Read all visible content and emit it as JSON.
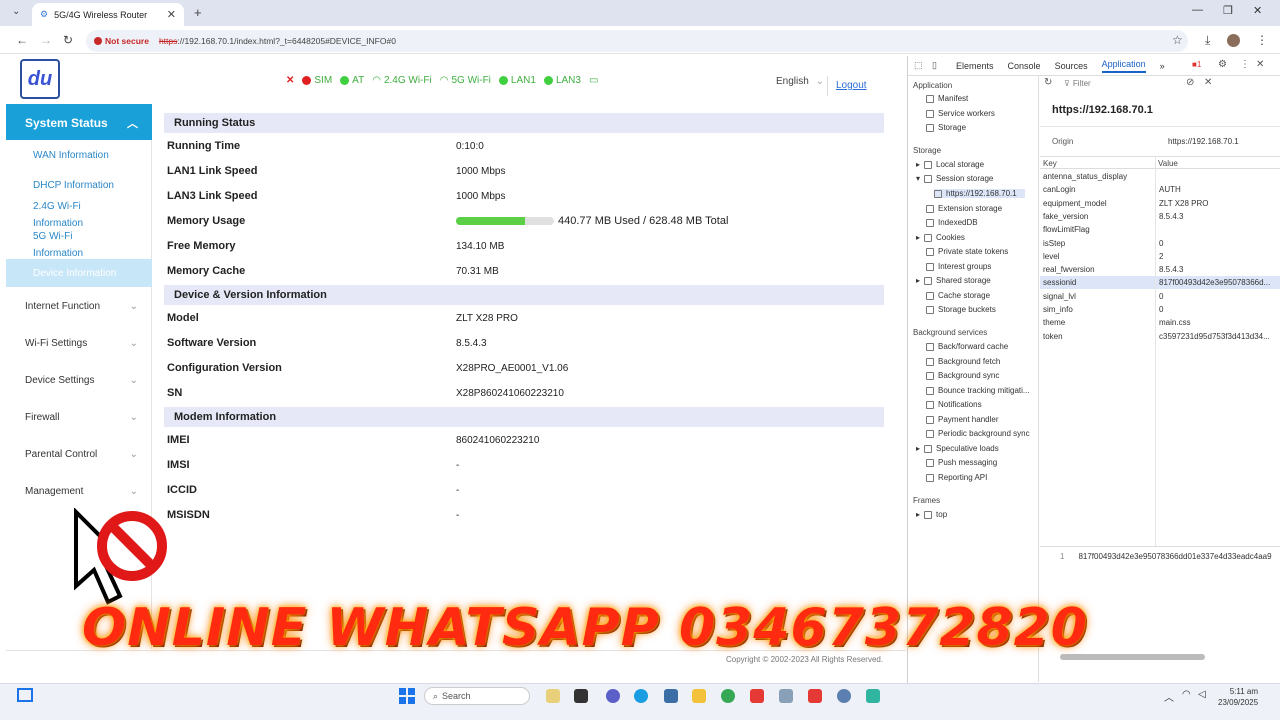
{
  "browser": {
    "tab_title": "5G/4G Wireless Router",
    "not_secure": "Not secure",
    "url_scheme": "https",
    "url_rest": "://192.168.70.1/index.html?_t=6448205#DEVICE_INFO#0"
  },
  "header": {
    "logo_text": "du",
    "status": [
      {
        "label": "SIM",
        "color": "#e02020"
      },
      {
        "label": "AT",
        "color": "#3fcf3f"
      },
      {
        "label": "2.4G Wi-Fi",
        "color": "#3fcf3f"
      },
      {
        "label": "5G Wi-Fi",
        "color": "#3fcf3f"
      },
      {
        "label": "LAN1",
        "color": "#3fcf3f"
      },
      {
        "label": "LAN3",
        "color": "#3fcf3f"
      }
    ],
    "language": "English",
    "logout": "Logout"
  },
  "sidebar": {
    "system_status": "System Status",
    "sub_items": [
      "WAN Information",
      "DHCP Information",
      "2.4G Wi-Fi",
      "Information",
      "5G Wi-Fi",
      "Information",
      "Device Information"
    ],
    "menus": [
      "Internet Function",
      "Wi-Fi Settings",
      "Device Settings",
      "Firewall",
      "Parental Control",
      "Management"
    ]
  },
  "running_status": {
    "title": "Running Status",
    "rows": [
      {
        "label": "Running Time",
        "value": "0:10:0"
      },
      {
        "label": "LAN1 Link Speed",
        "value": "1000 Mbps"
      },
      {
        "label": "LAN3 Link Speed",
        "value": "1000 Mbps"
      },
      {
        "label": "Memory Usage",
        "value": ""
      },
      {
        "label": "Free Memory",
        "value": "134.10 MB"
      },
      {
        "label": "Memory Cache",
        "value": "70.31 MB"
      }
    ],
    "memory_text": "440.77 MB Used / 628.48 MB Total",
    "memory_used_fraction": 0.7
  },
  "device_version": {
    "title": "Device & Version Information",
    "rows": [
      {
        "label": "Model",
        "value": "ZLT X28 PRO"
      },
      {
        "label": "Software Version",
        "value": "8.5.4.3"
      },
      {
        "label": "Configuration Version",
        "value": "X28PRO_AE0001_V1.06"
      },
      {
        "label": "SN",
        "value": "X28P860241060223210"
      }
    ]
  },
  "modem": {
    "title": "Modem Information",
    "rows": [
      {
        "label": "IMEI",
        "value": "860241060223210"
      },
      {
        "label": "IMSI",
        "value": "-"
      },
      {
        "label": "ICCID",
        "value": "-"
      },
      {
        "label": "MSISDN",
        "value": "-"
      }
    ]
  },
  "copyright": "Copyright © 2002-2023 All Rights Reserved.",
  "devtools": {
    "tabs": [
      "Elements",
      "Console",
      "Sources",
      "Application"
    ],
    "active_tab": "Application",
    "filter_placeholder": "Filter",
    "origin_host": "https://192.168.70.1",
    "origin_label": "Origin",
    "origin_value": "https://192.168.70.1",
    "key_header": "Key",
    "value_header": "Value",
    "tree": {
      "application_title": "Application",
      "application": [
        "Manifest",
        "Service workers",
        "Storage"
      ],
      "storage_title": "Storage",
      "storage": [
        "Local storage",
        "Session storage",
        "https://192.168.70.1",
        "Extension storage",
        "IndexedDB",
        "Cookies",
        "Private state tokens",
        "Interest groups",
        "Shared storage",
        "Cache storage",
        "Storage buckets"
      ],
      "background_title": "Background services",
      "background": [
        "Back/forward cache",
        "Background fetch",
        "Background sync",
        "Bounce tracking mitigati...",
        "Notifications",
        "Payment handler",
        "Periodic background sync",
        "Speculative loads",
        "Push messaging",
        "Reporting API"
      ],
      "frames_title": "Frames",
      "frames": [
        "top"
      ]
    },
    "entries": [
      {
        "key": "antenna_status_display",
        "value": ""
      },
      {
        "key": "canLogin",
        "value": "AUTH"
      },
      {
        "key": "equipment_model",
        "value": "ZLT X28 PRO"
      },
      {
        "key": "fake_version",
        "value": "8.5.4.3"
      },
      {
        "key": "flowLimitFlag",
        "value": ""
      },
      {
        "key": "isStep",
        "value": "0"
      },
      {
        "key": "level",
        "value": "2"
      },
      {
        "key": "real_fwversion",
        "value": "8.5.4.3"
      },
      {
        "key": "sessionid",
        "value": "817f00493d42e3e95078366d..."
      },
      {
        "key": "signal_lvl",
        "value": "0"
      },
      {
        "key": "sim_info",
        "value": "0"
      },
      {
        "key": "theme",
        "value": "main.css"
      },
      {
        "key": "token",
        "value": "c3597231d95d753f3d413d34..."
      }
    ],
    "preview_line": "1",
    "preview_value": "817f00493d42e3e95078366dd01e337e4d33eadc4aa9"
  },
  "overlay": {
    "banner": "ONLINE WHATSAPP 03467372820"
  },
  "taskbar": {
    "search": "Search",
    "time": "5:11 am",
    "date": "23/09/2025"
  }
}
